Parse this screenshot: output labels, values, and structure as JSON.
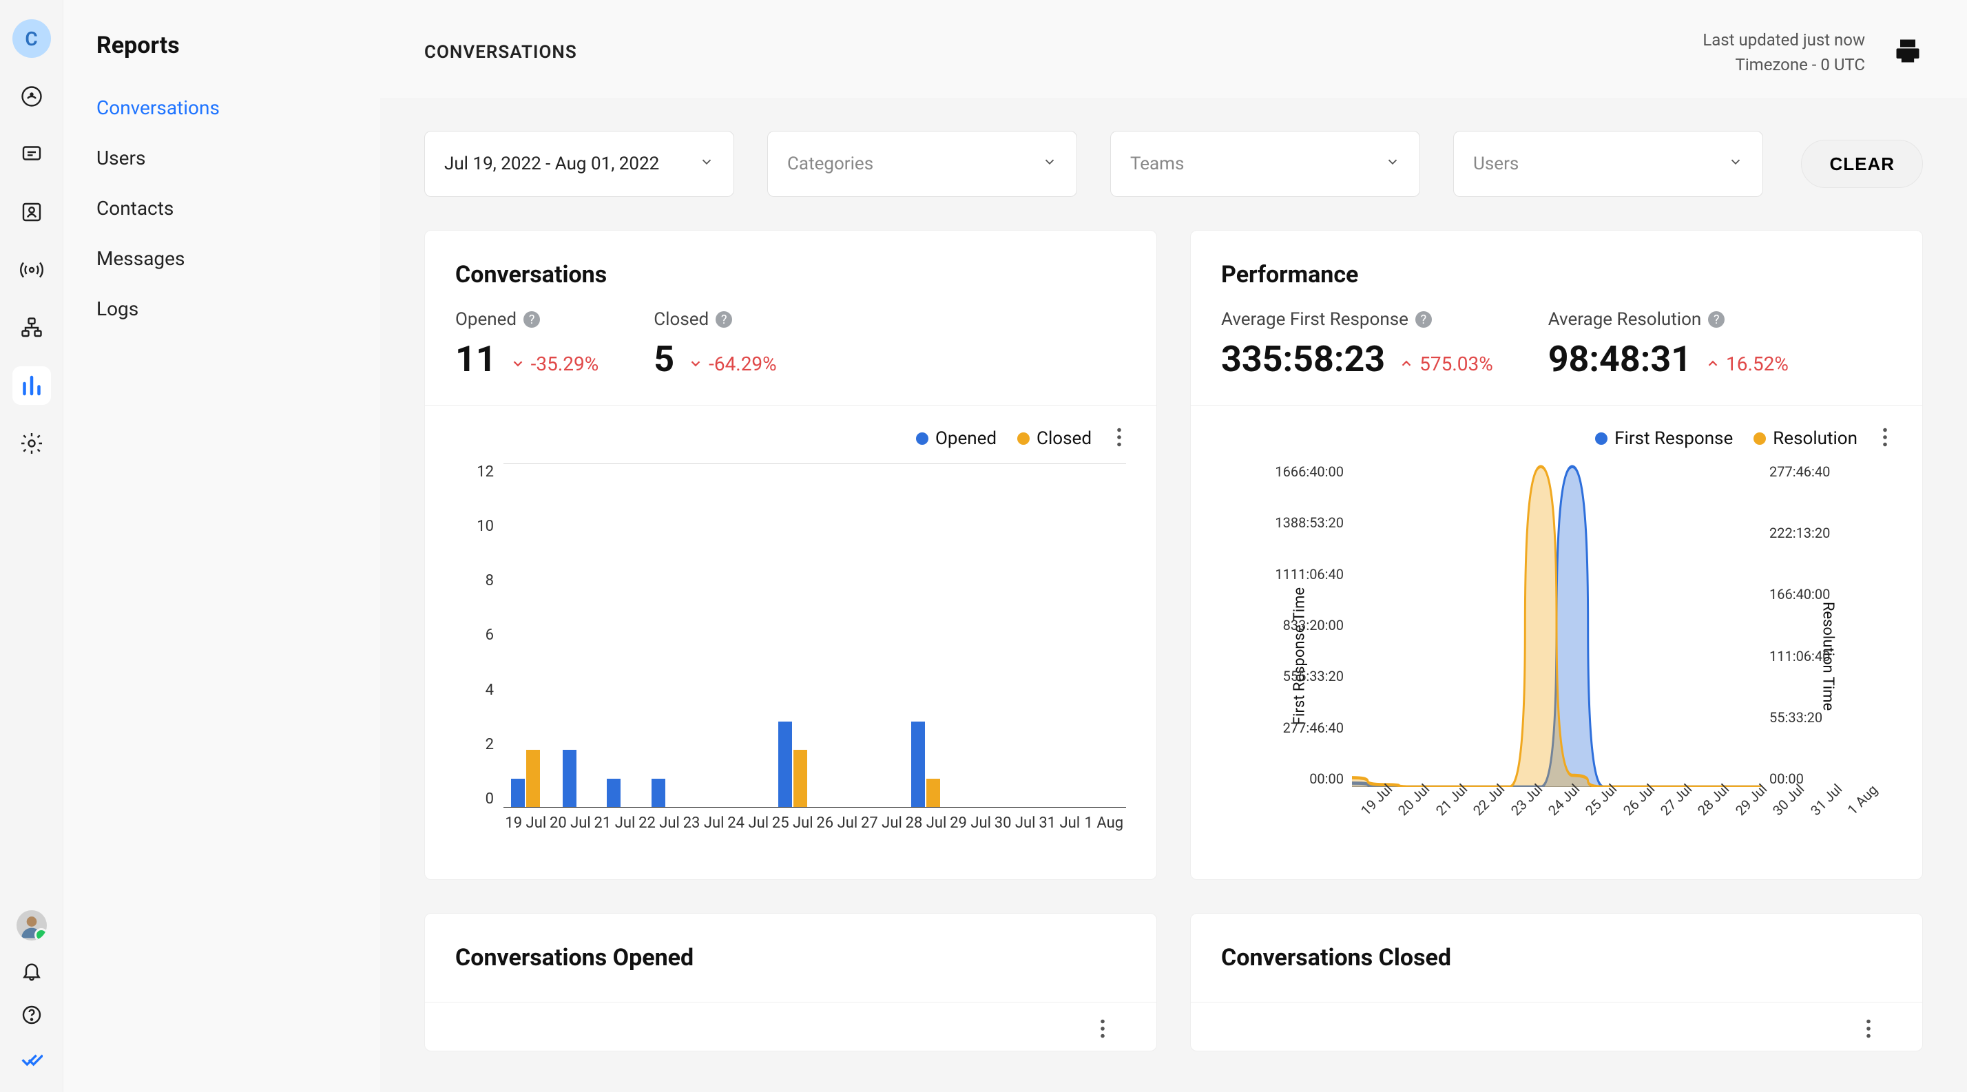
{
  "avatar_letter": "C",
  "side_nav": {
    "title": "Reports",
    "items": [
      "Conversations",
      "Users",
      "Contacts",
      "Messages",
      "Logs"
    ],
    "active_index": 0
  },
  "topbar": {
    "title": "CONVERSATIONS",
    "last_updated": "Last updated just now",
    "timezone": "Timezone - 0 UTC"
  },
  "filters": {
    "date_range": "Jul 19, 2022 - Aug 01, 2022",
    "categories_placeholder": "Categories",
    "teams_placeholder": "Teams",
    "users_placeholder": "Users",
    "clear_label": "CLEAR"
  },
  "cards": {
    "conversations": {
      "title": "Conversations",
      "opened_label": "Opened",
      "opened_value": "11",
      "opened_trend": "-35.29%",
      "closed_label": "Closed",
      "closed_value": "5",
      "closed_trend": "-64.29%",
      "legend_opened": "Opened",
      "legend_closed": "Closed"
    },
    "performance": {
      "title": "Performance",
      "afr_label": "Average First Response",
      "afr_value": "335:58:23",
      "afr_trend": "575.03%",
      "ar_label": "Average Resolution",
      "ar_value": "98:48:31",
      "ar_trend": "16.52%",
      "legend_first": "First Response",
      "legend_resolution": "Resolution",
      "y_title_left": "First Response Time",
      "y_title_right": "Resolution Time"
    },
    "opened_small": {
      "title": "Conversations Opened"
    },
    "closed_small": {
      "title": "Conversations Closed"
    }
  },
  "colors": {
    "blue": "#2e6fdb",
    "orange": "#f0a820",
    "red": "#e04848",
    "accent": "#1f74ff"
  },
  "chart_data": [
    {
      "type": "bar",
      "title": "Conversations",
      "ylim": [
        0,
        12
      ],
      "yticks": [
        0,
        2,
        4,
        6,
        8,
        10,
        12
      ],
      "categories": [
        "19 Jul",
        "20 Jul",
        "21 Jul",
        "22 Jul",
        "23 Jul",
        "24 Jul",
        "25 Jul",
        "26 Jul",
        "27 Jul",
        "28 Jul",
        "29 Jul",
        "30 Jul",
        "31 Jul",
        "1 Aug"
      ],
      "series": [
        {
          "name": "Opened",
          "color": "#2e6fdb",
          "values": [
            1,
            2,
            1,
            1,
            0,
            0,
            3,
            0,
            0,
            3,
            0,
            0,
            0,
            0
          ]
        },
        {
          "name": "Closed",
          "color": "#f0a820",
          "values": [
            2,
            0,
            0,
            0,
            0,
            0,
            2,
            0,
            0,
            1,
            0,
            0,
            0,
            0
          ]
        }
      ]
    },
    {
      "type": "area",
      "title": "Performance",
      "x": [
        "19 Jul",
        "20 Jul",
        "21 Jul",
        "22 Jul",
        "23 Jul",
        "24 Jul",
        "25 Jul",
        "26 Jul",
        "27 Jul",
        "28 Jul",
        "29 Jul",
        "30 Jul",
        "31 Jul",
        "1 Aug"
      ],
      "y_left_ticks": [
        "00:00",
        "277:46:40",
        "555:33:20",
        "833:20:00",
        "1111:06:40",
        "1388:53:20",
        "1666:40:00"
      ],
      "y_right_ticks": [
        "00:00",
        "55:33:20",
        "111:06:40",
        "166:40:00",
        "222:13:20",
        "277:46:40"
      ],
      "y_left_label": "First Response Time",
      "y_right_label": "Resolution Time",
      "series": [
        {
          "name": "First Response",
          "axis": "left",
          "color": "#2e6fdb",
          "values_hours": [
            20,
            5,
            0,
            0,
            0,
            0,
            0,
            1650,
            0,
            0,
            0,
            0,
            0,
            0
          ]
        },
        {
          "name": "Resolution",
          "axis": "right",
          "color": "#f0a820",
          "values_hours": [
            8,
            2,
            0,
            0,
            0,
            0,
            275,
            10,
            0,
            0,
            0,
            0,
            0,
            0
          ]
        }
      ]
    }
  ]
}
